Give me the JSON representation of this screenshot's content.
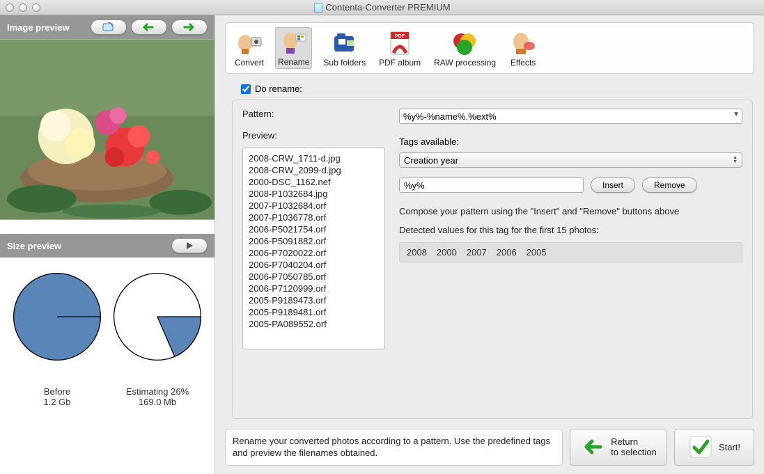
{
  "window": {
    "title": "Contenta-Converter PREMIUM"
  },
  "left": {
    "image_preview_label": "Image preview",
    "size_preview_label": "Size preview",
    "before_label": "Before",
    "before_value": "1.2 Gb",
    "estimating_label": "Estimating 26%",
    "estimating_value": "169.0 Mb"
  },
  "toolbar": {
    "convert": "Convert",
    "rename": "Rename",
    "subfolders": "Sub folders",
    "pdfalbum": "PDF album",
    "raw": "RAW processing",
    "effects": "Effects"
  },
  "rename": {
    "do_rename_label": "Do rename:",
    "pattern_label": "Pattern:",
    "pattern_value": "%y%-%name%.%ext%",
    "preview_label": "Preview:",
    "preview_items": [
      "2008-CRW_1711-d.jpg",
      "2008-CRW_2099-d.jpg",
      "2000-DSC_1162.nef",
      "2008-P1032684.jpg",
      "2007-P1032684.orf",
      "2007-P1036778.orf",
      "2006-P5021754.orf",
      "2006-P5091882.orf",
      "2006-P7020022.orf",
      "2006-P7040204.orf",
      "2006-P7050785.orf",
      "2006-P7120999.orf",
      "2005-P9189473.orf",
      "2005-P9189481.orf",
      "2005-PA089552.orf"
    ],
    "tags_available_label": "Tags available:",
    "tag_selected": "Creation year",
    "tag_input_value": "%y%",
    "insert_label": "Insert",
    "remove_label": "Remove",
    "compose_text": "Compose your pattern using the \"Insert\" and \"Remove\" buttons above",
    "detected_text": "Detected values for this tag for the first 15 photos:",
    "detected_values": [
      "2008",
      "2000",
      "2007",
      "2006",
      "2005"
    ]
  },
  "bottom": {
    "hint": "Rename your converted photos according to a pattern. Use the predefined tags and preview the filenames obtained.",
    "return_label": "Return\nto selection",
    "start_label": "Start!"
  },
  "chart_data": [
    {
      "type": "pie",
      "title": "Before",
      "series": [
        {
          "name": "used",
          "value": 100
        }
      ],
      "values_pct": [
        100
      ]
    },
    {
      "type": "pie",
      "title": "Estimating 26%",
      "series": [
        {
          "name": "used",
          "value": 26
        },
        {
          "name": "free",
          "value": 74
        }
      ],
      "values_pct": [
        26,
        74
      ]
    }
  ]
}
